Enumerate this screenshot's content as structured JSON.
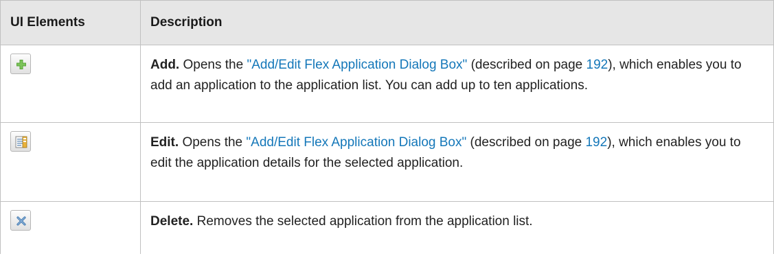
{
  "header": {
    "col_ui": "UI Elements",
    "col_desc": "Description"
  },
  "rows": [
    {
      "icon": "add-icon",
      "term": "Add.",
      "pre": " Opens the ",
      "link": "\"Add/Edit Flex Application Dialog Box\"",
      "mid": " (described on page ",
      "page": "192",
      "post": "), which enables you to add an application to the application list. You can add up to ten applications."
    },
    {
      "icon": "edit-icon",
      "term": "Edit.",
      "pre": " Opens the ",
      "link": "\"Add/Edit Flex Application Dialog Box\"",
      "mid": " (described on page ",
      "page": "192",
      "post": "), which enables you to edit the application details for the selected application."
    },
    {
      "icon": "delete-icon",
      "term": "Delete.",
      "text": " Removes the selected application from the application list."
    }
  ],
  "colors": {
    "link": "#1477b9",
    "header_bg": "#e6e6e6",
    "border": "#c0c0c0",
    "add_icon": "#5aa53a",
    "delete_icon": "#4a7fb5"
  }
}
